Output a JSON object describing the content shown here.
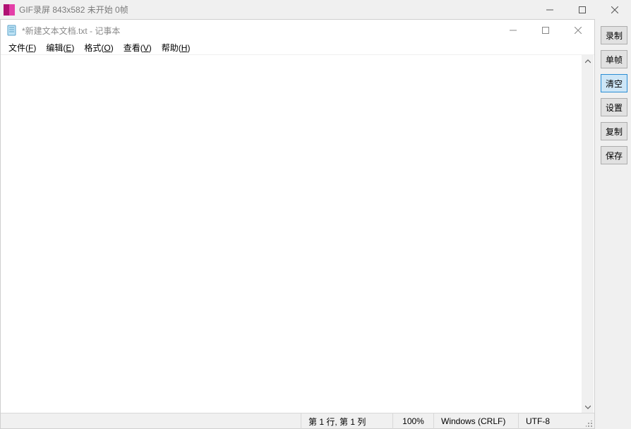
{
  "gif": {
    "title": "GIF录屏 843x582 未开始 0帧",
    "sidebar": [
      {
        "label": "录制",
        "active": false
      },
      {
        "label": "单帧",
        "active": false
      },
      {
        "label": "清空",
        "active": true
      },
      {
        "label": "设置",
        "active": false
      },
      {
        "label": "复制",
        "active": false
      },
      {
        "label": "保存",
        "active": false
      }
    ]
  },
  "notepad": {
    "title": "*新建文本文档.txt - 记事本",
    "menu": {
      "file": {
        "text": "文件",
        "accel": "F"
      },
      "edit": {
        "text": "编辑",
        "accel": "E"
      },
      "format": {
        "text": "格式",
        "accel": "O"
      },
      "view": {
        "text": "查看",
        "accel": "V"
      },
      "help": {
        "text": "帮助",
        "accel": "H"
      }
    },
    "content": "",
    "status": {
      "position": "第 1 行, 第 1 列",
      "zoom": "100%",
      "eol": "Windows (CRLF)",
      "encoding": "UTF-8"
    }
  }
}
